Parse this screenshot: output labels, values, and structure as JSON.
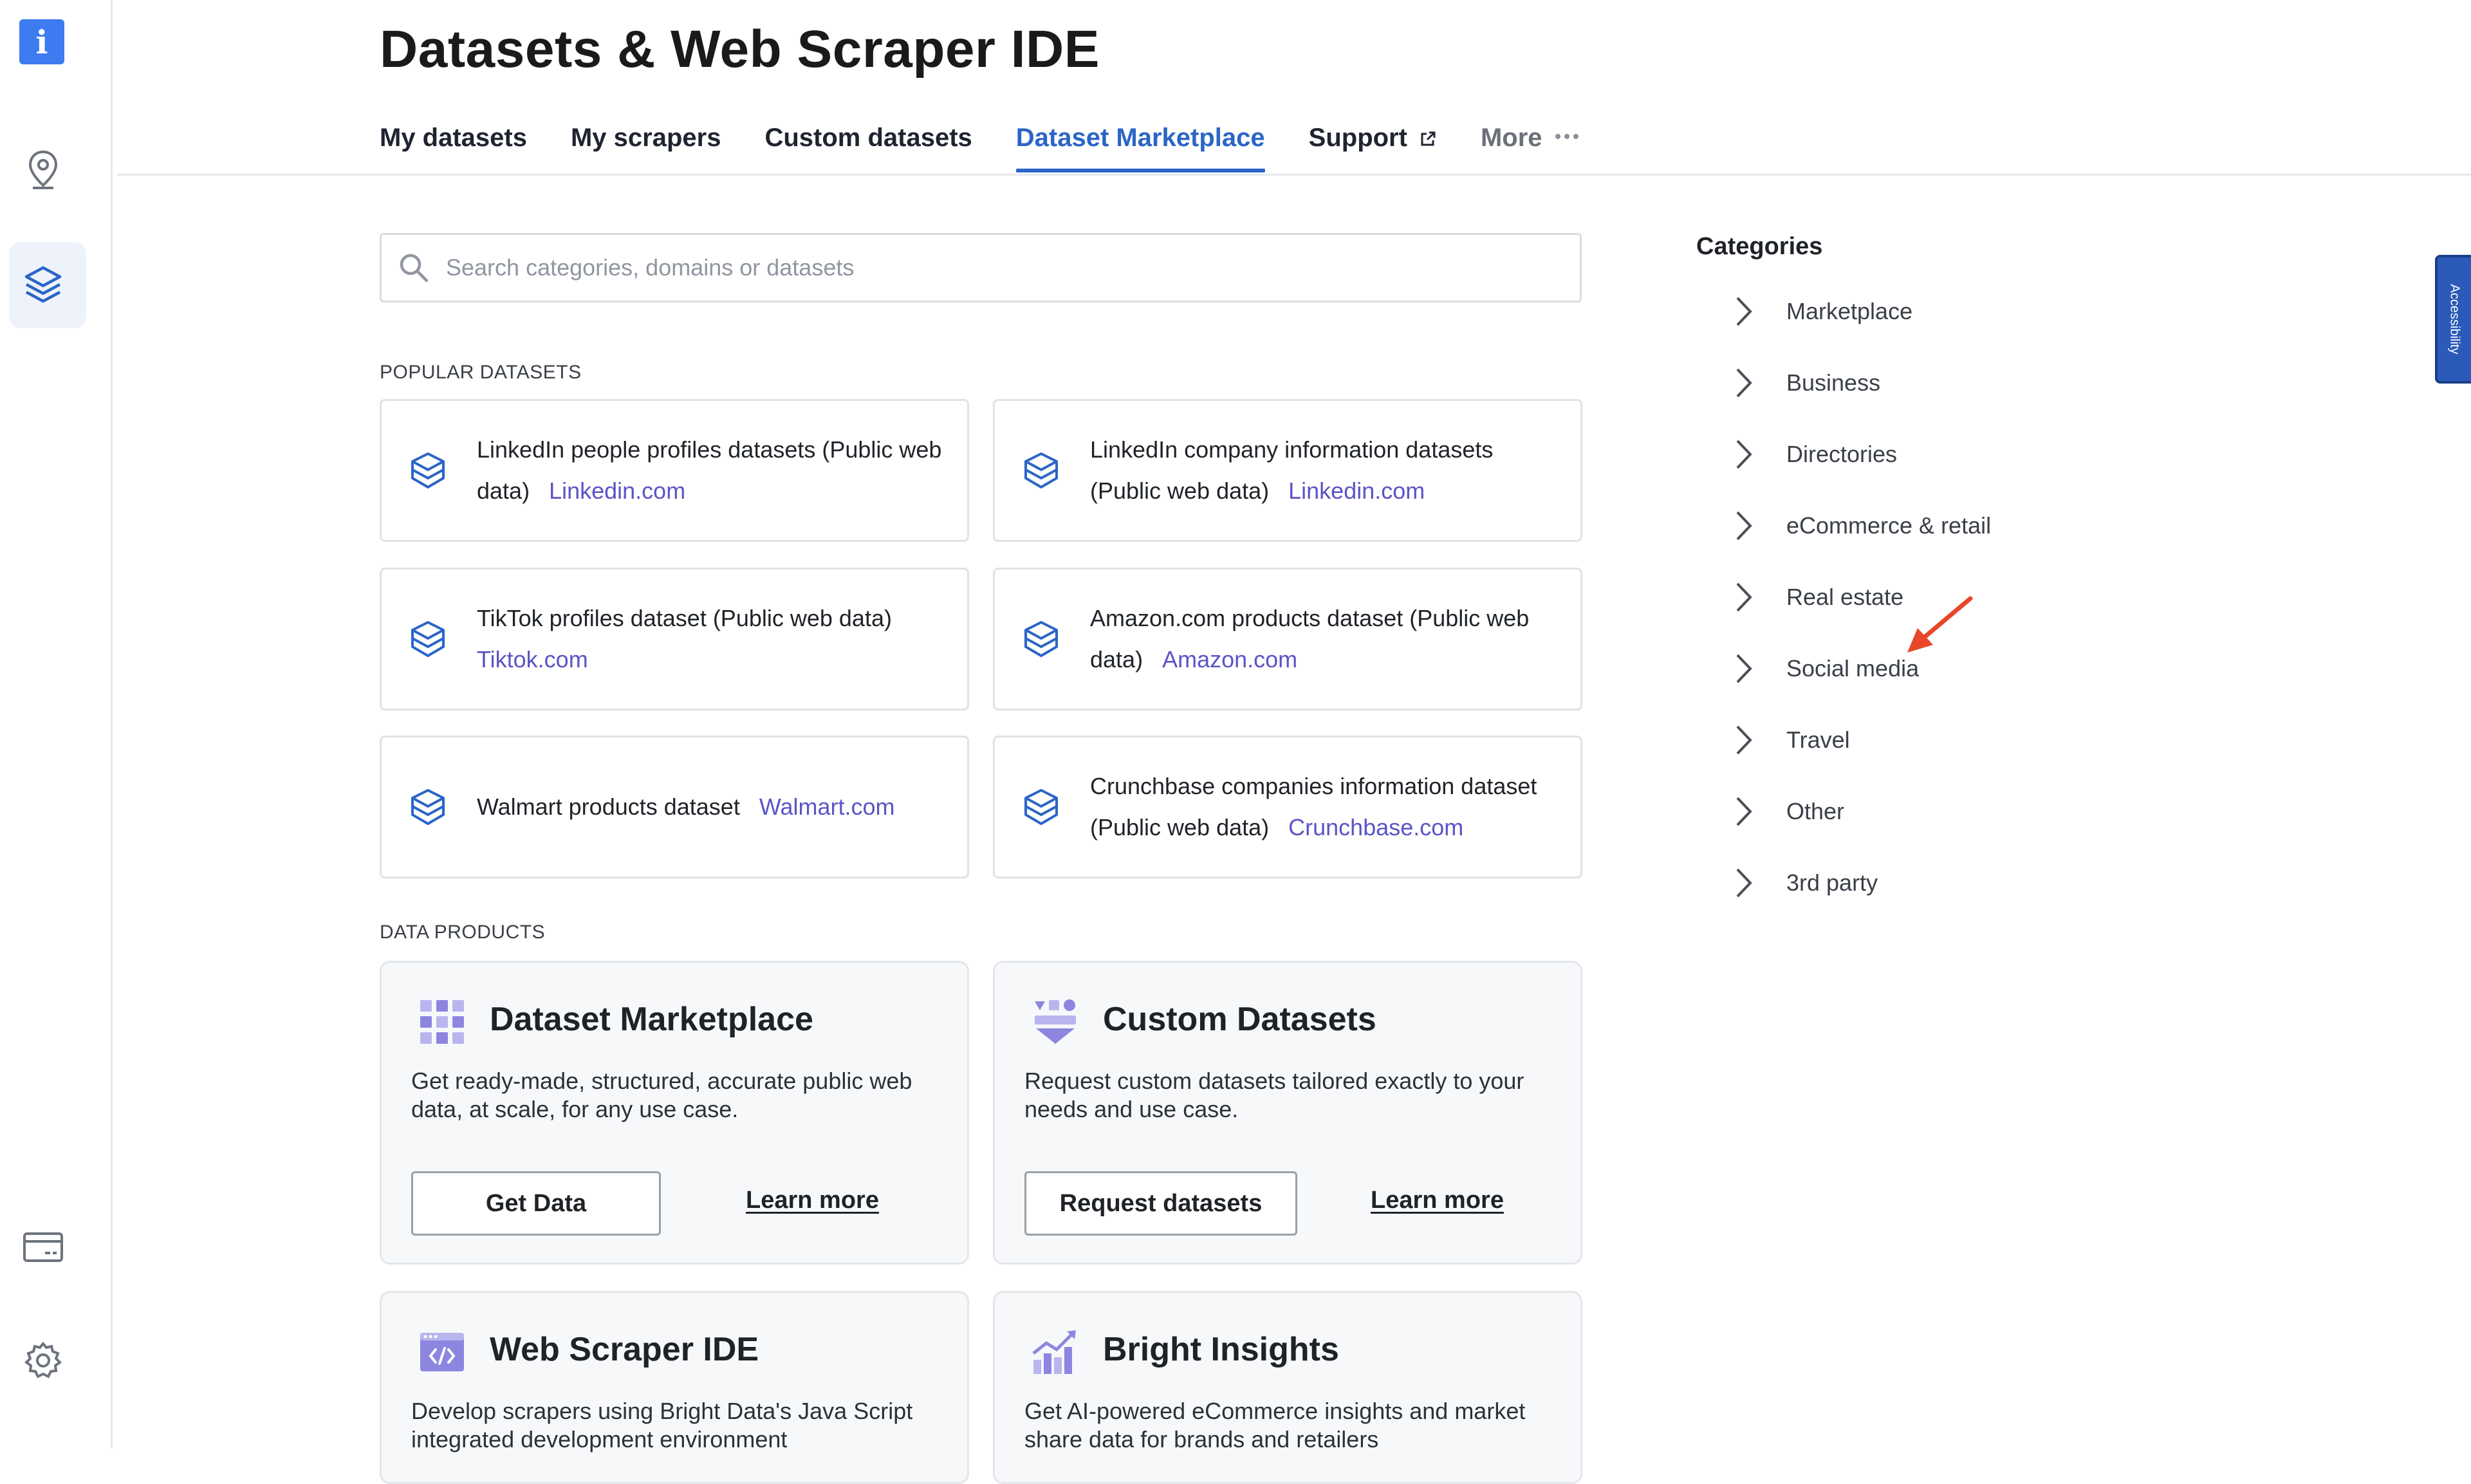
{
  "app": {
    "logo_glyph": "i",
    "accent": "#2b65c6"
  },
  "rail": {
    "icons": [
      "info-logo-icon",
      "location-pin-icon",
      "layers-icon",
      "billing-card-icon",
      "settings-gear-icon"
    ]
  },
  "header": {
    "title": "Datasets & Web Scraper IDE",
    "tabs": [
      {
        "label": "My datasets"
      },
      {
        "label": "My scrapers"
      },
      {
        "label": "Custom datasets"
      },
      {
        "label": "Dataset Marketplace",
        "active": true
      },
      {
        "label": "Support"
      },
      {
        "label": "More"
      }
    ]
  },
  "search": {
    "placeholder": "Search categories, domains or datasets"
  },
  "popular": {
    "heading": "POPULAR DATASETS",
    "items": [
      {
        "name": "LinkedIn people profiles datasets (Public web data)",
        "domain": "Linkedin.com"
      },
      {
        "name": "LinkedIn company information datasets (Public web data)",
        "domain": "Linkedin.com"
      },
      {
        "name": "TikTok profiles dataset (Public web data)",
        "domain": "Tiktok.com"
      },
      {
        "name": "Amazon.com products dataset (Public web data)",
        "domain": "Amazon.com"
      },
      {
        "name": "Walmart products dataset",
        "domain": "Walmart.com"
      },
      {
        "name": "Crunchbase companies information dataset (Public web data)",
        "domain": "Crunchbase.com"
      }
    ]
  },
  "products": {
    "heading": "DATA PRODUCTS",
    "items": [
      {
        "title": "Dataset Marketplace",
        "description": "Get ready-made, structured, accurate public web data, at scale, for any use case.",
        "button": "Get Data",
        "link": "Learn more"
      },
      {
        "title": "Custom Datasets",
        "description": "Request custom datasets tailored exactly to your needs and use case.",
        "button": "Request datasets",
        "link": "Learn more"
      },
      {
        "title": "Web Scraper IDE",
        "description": "Develop scrapers using Bright Data's Java Script integrated development environment"
      },
      {
        "title": "Bright Insights",
        "description": "Get AI-powered eCommerce insights and market share data for brands and retailers"
      }
    ]
  },
  "categories": {
    "heading": "Categories",
    "items": [
      "Marketplace",
      "Business",
      "Directories",
      "eCommerce & retail",
      "Real estate",
      "Social media",
      "Travel",
      "Other",
      "3rd party"
    ]
  },
  "annotation": {
    "arrow_color": "#e8472a"
  },
  "accessibility": {
    "label": "Accessibility"
  }
}
